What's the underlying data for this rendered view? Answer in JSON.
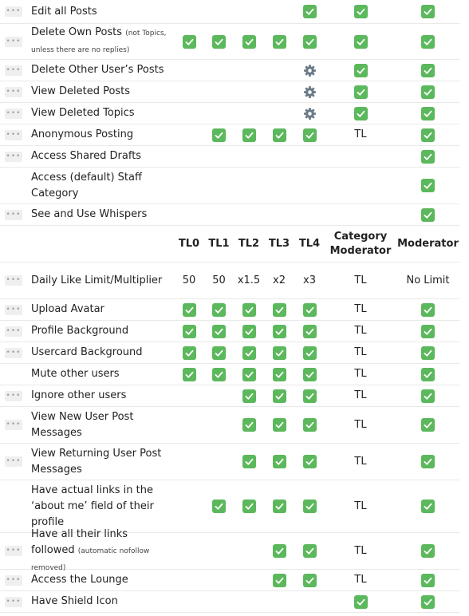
{
  "header": {
    "tl0": "TL0",
    "tl1": "TL1",
    "tl2": "TL2",
    "tl3": "TL3",
    "tl4": "TL4",
    "category_moderator": "Category Moderator",
    "moderator": "Moderator"
  },
  "rows": [
    {
      "label": "Edit all Posts",
      "handle": true,
      "h": 30,
      "cells": [
        "",
        "",
        "",
        "",
        "check",
        "check",
        "check"
      ]
    },
    {
      "label": "Delete Own Posts",
      "note": "(not Topics, unless there are no replies)",
      "handle": true,
      "h": 45,
      "cells": [
        "check",
        "check",
        "check",
        "check",
        "check",
        "check",
        "check"
      ]
    },
    {
      "label": "Delete Other User’s Posts",
      "handle": true,
      "h": 27,
      "cells": [
        "",
        "",
        "",
        "",
        "gear",
        "check",
        "check"
      ]
    },
    {
      "label": "View Deleted Posts",
      "handle": true,
      "h": 27,
      "cells": [
        "",
        "",
        "",
        "",
        "gear",
        "check",
        "check"
      ]
    },
    {
      "label": "View Deleted Topics",
      "handle": true,
      "h": 27,
      "cells": [
        "",
        "",
        "",
        "",
        "gear",
        "check",
        "check"
      ]
    },
    {
      "label": "Anonymous Posting",
      "handle": true,
      "h": 27,
      "cells": [
        "",
        "check",
        "check",
        "check",
        "check",
        "TL",
        "check"
      ]
    },
    {
      "label": "Access Shared Drafts",
      "handle": true,
      "h": 27,
      "cells": [
        "",
        "",
        "",
        "",
        "",
        "",
        "check"
      ]
    },
    {
      "label": "Access (default) Staff Category",
      "handle": false,
      "h": 46,
      "cells": [
        "",
        "",
        "",
        "",
        "",
        "",
        "check"
      ]
    },
    {
      "label": "See and Use Whispers",
      "handle": true,
      "h": 27,
      "cells": [
        "",
        "",
        "",
        "",
        "",
        "",
        "check"
      ]
    },
    {
      "header": true,
      "h": 46
    },
    {
      "label": "Daily Like Limit/Multiplier",
      "handle": true,
      "h": 46,
      "cells": [
        "50",
        "50",
        "x1.5",
        "x2",
        "x3",
        "TL",
        "No Limit"
      ]
    },
    {
      "label": "Upload Avatar",
      "handle": true,
      "h": 27,
      "cells": [
        "check",
        "check",
        "check",
        "check",
        "check",
        "TL",
        "check"
      ]
    },
    {
      "label": "Profile Background",
      "handle": true,
      "h": 27,
      "cells": [
        "check",
        "check",
        "check",
        "check",
        "check",
        "TL",
        "check"
      ]
    },
    {
      "label": "Usercard Background",
      "handle": true,
      "h": 27,
      "cells": [
        "check",
        "check",
        "check",
        "check",
        "check",
        "TL",
        "check"
      ]
    },
    {
      "label": "Mute other users",
      "handle": false,
      "h": 27,
      "cells": [
        "check",
        "check",
        "check",
        "check",
        "check",
        "TL",
        "check"
      ]
    },
    {
      "label": "Ignore other users",
      "handle": true,
      "h": 27,
      "cells": [
        "",
        "",
        "check",
        "check",
        "check",
        "TL",
        "check"
      ]
    },
    {
      "label": "View New User Post Messages",
      "handle": true,
      "h": 46,
      "cells": [
        "",
        "",
        "check",
        "check",
        "check",
        "TL",
        "check"
      ]
    },
    {
      "label": "View Returning User Post Messages",
      "handle": true,
      "h": 46,
      "cells": [
        "",
        "",
        "check",
        "check",
        "check",
        "TL",
        "check"
      ]
    },
    {
      "label": "Have actual links in the ‘about me’ field of their profile",
      "handle": false,
      "h": 66,
      "cells": [
        "",
        "check",
        "check",
        "check",
        "check",
        "TL",
        "check"
      ]
    },
    {
      "label": "Have all their links followed",
      "note": "(automatic nofollow removed)",
      "handle": true,
      "h": 46,
      "cells": [
        "",
        "",
        "",
        "check",
        "check",
        "TL",
        "check"
      ]
    },
    {
      "label": "Access the Lounge",
      "handle": true,
      "h": 27,
      "cells": [
        "",
        "",
        "",
        "check",
        "check",
        "TL",
        "check"
      ]
    },
    {
      "label": "Have Shield Icon",
      "handle": true,
      "h": 27,
      "cells": [
        "",
        "",
        "",
        "",
        "",
        "check",
        "check"
      ]
    }
  ],
  "icons": {
    "check": "checkmark-icon",
    "gear": "gear-icon",
    "handle": "drag-handle-icon"
  },
  "colors": {
    "check_bg": "#5cb85c",
    "gear": "#6c7a86",
    "handle_bg": "#efefef"
  }
}
